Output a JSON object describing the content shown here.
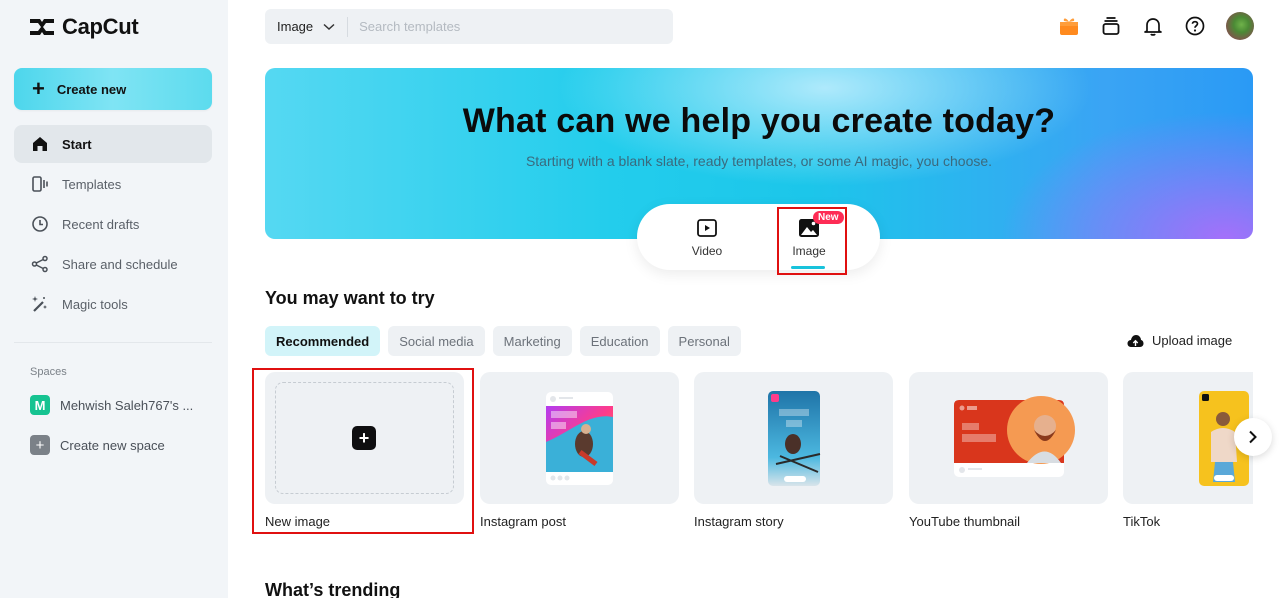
{
  "app": {
    "name": "CapCut"
  },
  "sidebar": {
    "create_label": "Create new",
    "nav": [
      {
        "label": "Start",
        "icon": "home-icon",
        "active": true
      },
      {
        "label": "Templates",
        "icon": "templates-icon",
        "active": false
      },
      {
        "label": "Recent drafts",
        "icon": "clock-icon",
        "active": false
      },
      {
        "label": "Share and schedule",
        "icon": "share-icon",
        "active": false
      },
      {
        "label": "Magic tools",
        "icon": "magic-wand-icon",
        "active": false
      }
    ],
    "spaces_label": "Spaces",
    "spaces": [
      {
        "avatar_letter": "M",
        "label": "Mehwish Saleh767's ..."
      }
    ],
    "create_space_label": "Create new space"
  },
  "topbar": {
    "search_type": "Image",
    "search_placeholder": "Search templates",
    "search_value": "",
    "icons": [
      "gift-icon",
      "wallet-icon",
      "bell-icon",
      "help-icon",
      "avatar"
    ]
  },
  "hero": {
    "title": "What can we help you create today?",
    "subtitle": "Starting with a blank slate, ready templates, or some AI magic, you choose.",
    "modes": [
      {
        "label": "Video",
        "icon": "video-icon",
        "selected": false
      },
      {
        "label": "Image",
        "icon": "image-icon",
        "selected": true,
        "badge": "New"
      }
    ]
  },
  "suggest": {
    "title": "You may want to try",
    "chips": [
      {
        "label": "Recommended",
        "active": true
      },
      {
        "label": "Social media",
        "active": false
      },
      {
        "label": "Marketing",
        "active": false
      },
      {
        "label": "Education",
        "active": false
      },
      {
        "label": "Personal",
        "active": false
      }
    ],
    "upload_label": "Upload image",
    "cards": [
      {
        "label": "New image"
      },
      {
        "label": "Instagram post"
      },
      {
        "label": "Instagram story"
      },
      {
        "label": "YouTube thumbnail"
      },
      {
        "label": "TikTok"
      }
    ]
  },
  "trending": {
    "title": "What’s trending"
  },
  "colors": {
    "accent": "#18c3dc",
    "highlight_box": "#e01010",
    "new_badge": "#fe2c55",
    "space_avatar": "#16c391"
  }
}
